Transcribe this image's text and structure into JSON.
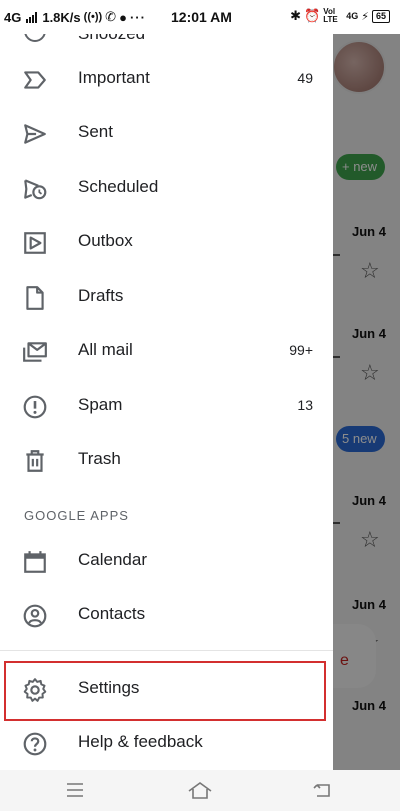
{
  "status_bar": {
    "network": "4G",
    "speed": "1.8K/s",
    "time": "12:01 AM",
    "lte": "Vol LTE",
    "network2": "4G",
    "battery": "65"
  },
  "drawer": {
    "partial_item": {
      "label": "Snoozed",
      "icon": "clock-icon"
    },
    "items": [
      {
        "label": "Important",
        "count": "49",
        "icon": "important-label-icon"
      },
      {
        "label": "Sent",
        "count": "",
        "icon": "send-icon"
      },
      {
        "label": "Scheduled",
        "count": "",
        "icon": "scheduled-send-icon"
      },
      {
        "label": "Outbox",
        "count": "",
        "icon": "outbox-icon"
      },
      {
        "label": "Drafts",
        "count": "",
        "icon": "draft-icon"
      },
      {
        "label": "All mail",
        "count": "99+",
        "icon": "all-mail-icon"
      },
      {
        "label": "Spam",
        "count": "13",
        "icon": "spam-icon"
      },
      {
        "label": "Trash",
        "count": "",
        "icon": "trash-icon"
      }
    ],
    "section_header": "GOOGLE APPS",
    "apps": [
      {
        "label": "Calendar",
        "icon": "calendar-icon"
      },
      {
        "label": "Contacts",
        "icon": "contacts-icon"
      }
    ],
    "footer_items": [
      {
        "label": "Settings",
        "icon": "gear-icon"
      },
      {
        "label": "Help & feedback",
        "icon": "help-icon"
      }
    ]
  },
  "background": {
    "new_badge_1": "+ new",
    "new_badge_2": "5 new",
    "dates": [
      "Jun 4",
      "Jun 4",
      "Jun 4",
      "Jun 4",
      "Jun 4"
    ]
  },
  "colors": {
    "highlight_border": "#d32f2f",
    "icon": "#5f6368",
    "badge_green": "#3fa54e",
    "badge_blue": "#2a6bd6"
  }
}
